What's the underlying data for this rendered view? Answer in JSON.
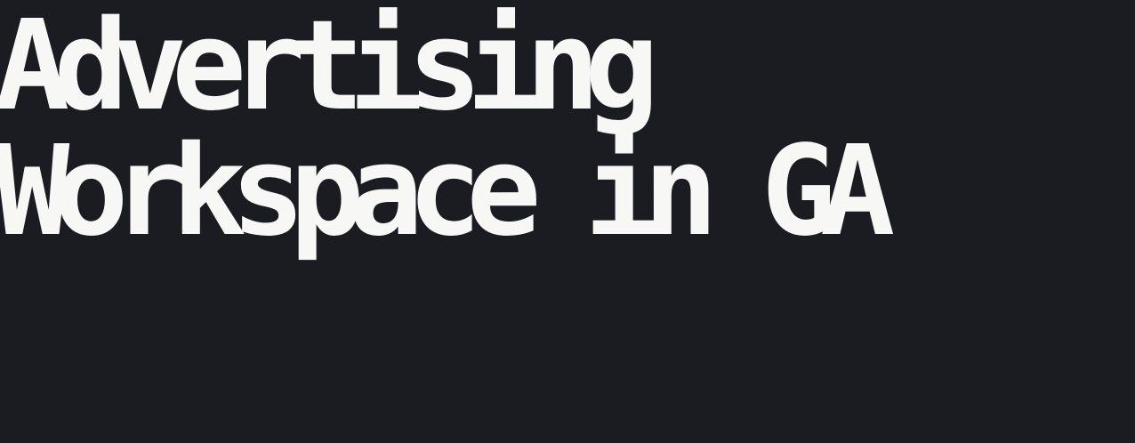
{
  "header": {
    "title_line_1": "Advertising",
    "title_line_2": "Workspace in GA"
  },
  "colors": {
    "background": "#1b1c21",
    "text": "#f7f7f5"
  }
}
